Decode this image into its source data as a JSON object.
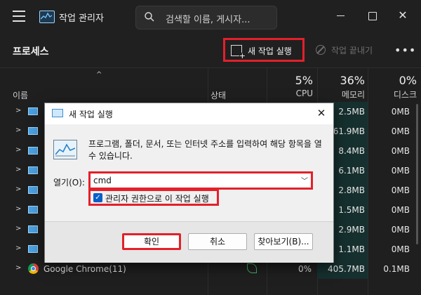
{
  "window": {
    "title": "작업 관리자",
    "search_placeholder": "검색할 이름, 게시자...",
    "close_glyph": "✕"
  },
  "toolbar": {
    "page_title": "프로세스",
    "run_task_label": "새 작업 실행",
    "end_task_label": "작업 끝내기",
    "more_glyph": "•••"
  },
  "columns": {
    "sort_glyph": "^",
    "name": "이름",
    "status": "상태",
    "cpu_pct": "5%",
    "cpu": "CPU",
    "mem_pct": "36%",
    "mem": "메모리",
    "disk_pct": "0%",
    "disk": "디스크"
  },
  "rows": [
    {
      "chevron": ">",
      "mem": "2.5MB",
      "disk": "0MB"
    },
    {
      "chevron": ">",
      "mem": "61.9MB",
      "disk": "0MB"
    },
    {
      "chevron": ">",
      "mem": "8.4MB",
      "disk": "0MB"
    },
    {
      "chevron": ">",
      "mem": "6.1MB",
      "disk": "0MB"
    },
    {
      "chevron": ">",
      "mem": "2.8MB",
      "disk": "0MB"
    },
    {
      "chevron": ">",
      "mem": "1.5MB",
      "disk": "0MB"
    },
    {
      "chevron": ">",
      "mem": "2.9MB",
      "disk": "0MB"
    },
    {
      "chevron": ">",
      "mem": "1.1MB",
      "disk": "0MB"
    }
  ],
  "chrome_row": {
    "chevron": ">",
    "name": "Google Chrome(11)",
    "cpu": "0%",
    "mem": "405.7MB",
    "disk": "0.1MB"
  },
  "dialog": {
    "title": "새 작업 실행",
    "close_glyph": "✕",
    "description": "프로그램, 폴더, 문서, 또는 인터넷 주소를 입력하여 해당 항목을 열 수 있습니다.",
    "open_label": "열기(O):",
    "open_value": "cmd",
    "dropdown_glyph": "﹀",
    "admin_checkbox_label": "관리자 권한으로 이 작업 실행",
    "admin_checked_glyph": "✓",
    "ok_label": "확인",
    "cancel_label": "취소",
    "browse_label": "찾아보기(B)..."
  }
}
